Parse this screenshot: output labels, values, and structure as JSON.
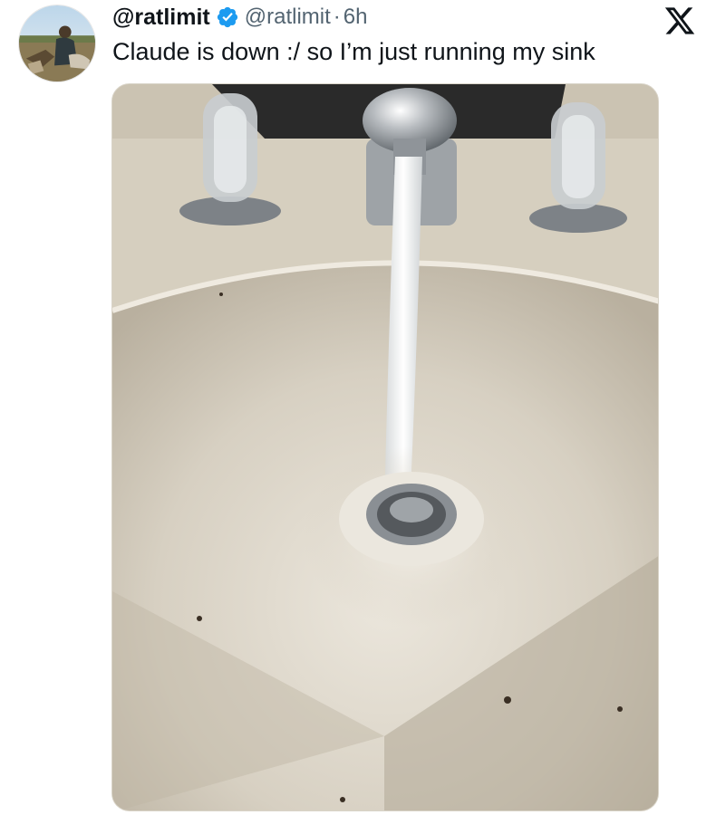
{
  "tweet": {
    "display_name": "@ratlimit",
    "handle": "@ratlimit",
    "separator": "·",
    "time": "6h",
    "text": "Claude is down :/ so I’m just running my sink"
  },
  "icons": {
    "verified": "verified-badge-icon",
    "platform": "x-logo-icon",
    "avatar": "avatar"
  },
  "media": {
    "subject": "photo"
  },
  "colors": {
    "verified_blue": "#1d9bf0",
    "handle_gray": "#536471",
    "text": "#0f1419"
  }
}
